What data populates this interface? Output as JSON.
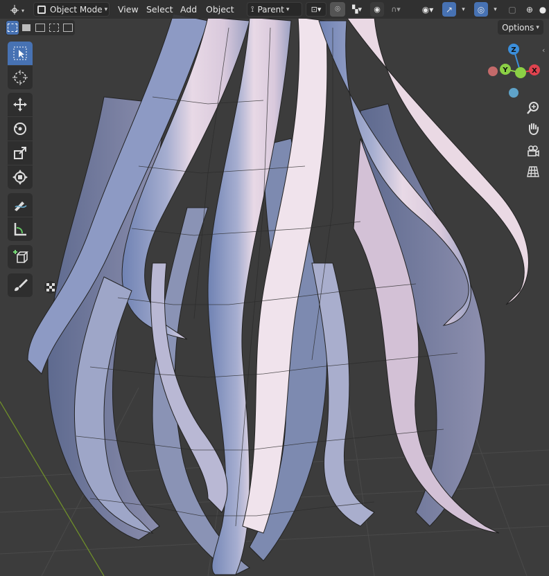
{
  "header": {
    "editor_type": "editor-type-icon",
    "mode": "Object Mode",
    "menus": [
      "View",
      "Select",
      "Add",
      "Object"
    ],
    "pivot": "Parent",
    "snapping": "snap-icon",
    "proportional": "proportional-edit-icon"
  },
  "toolbar_row": {
    "options_label": "Options"
  },
  "tools": [
    {
      "name": "select-box-tool",
      "icon": "cursor-box-icon",
      "active": true
    },
    {
      "name": "cursor-tool",
      "icon": "3d-cursor-icon"
    },
    {
      "name": "move-tool",
      "icon": "move-icon"
    },
    {
      "name": "rotate-tool",
      "icon": "rotate-icon"
    },
    {
      "name": "scale-tool",
      "icon": "scale-icon"
    },
    {
      "name": "transform-tool",
      "icon": "transform-icon"
    },
    {
      "name": "annotate-tool",
      "icon": "annotate-icon"
    },
    {
      "name": "measure-tool",
      "icon": "measure-icon"
    },
    {
      "name": "add-cube-tool",
      "icon": "add-cube-icon"
    },
    {
      "name": "paint-tool",
      "icon": "brush-icon"
    }
  ],
  "gizmo": {
    "axes": [
      "Z",
      "Y",
      "X"
    ],
    "colors": {
      "x": "#e0434f",
      "y": "#8bd045",
      "z": "#3b8fdc"
    }
  },
  "nav": [
    "zoom-icon",
    "hand-pan-icon",
    "camera-icon",
    "ortho-grid-icon"
  ],
  "colors": {
    "accent": "#4772b3",
    "hair_light": "#e9dbe7",
    "hair_dark": "#7d8fb8",
    "background": "#3a3a3a"
  }
}
